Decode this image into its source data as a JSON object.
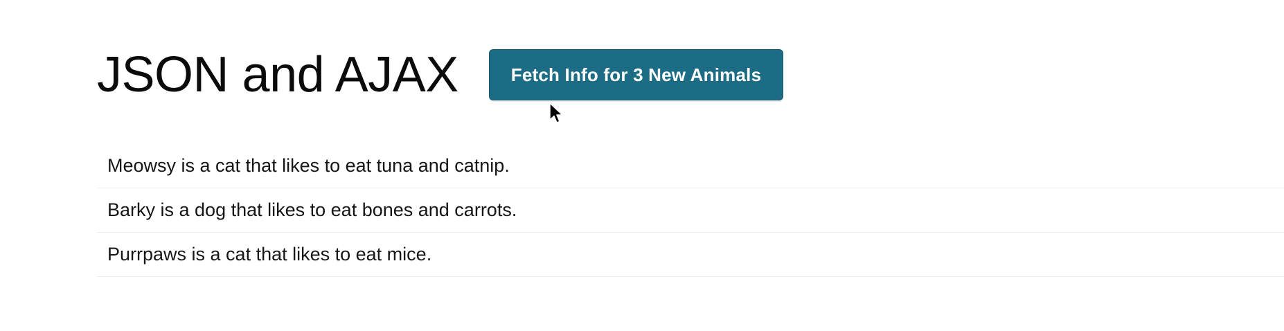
{
  "header": {
    "title": "JSON and AJAX",
    "fetch_button_label": "Fetch Info for 3 New Animals"
  },
  "animals": [
    "Meowsy is a cat that likes to eat tuna and catnip.",
    "Barky is a dog that likes to eat bones and carrots.",
    "Purrpaws is a cat that likes to eat mice."
  ],
  "colors": {
    "button_bg": "#1d6c86",
    "button_text": "#ffffff",
    "text": "#161616",
    "divider": "#ececec"
  },
  "icons": {
    "cursor": "mouse-pointer-icon"
  }
}
